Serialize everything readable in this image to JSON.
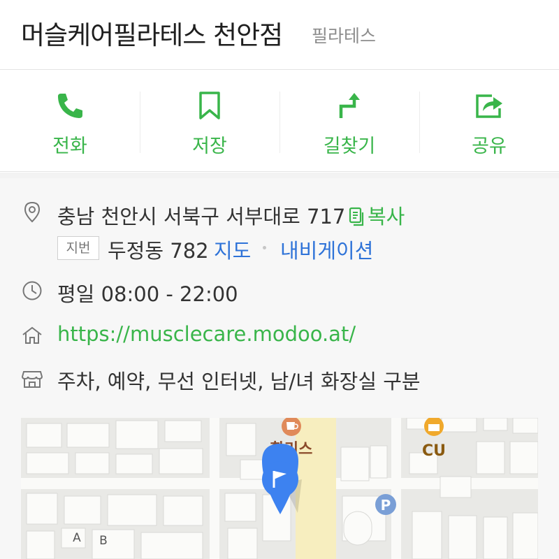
{
  "place": {
    "name": "머슬케어필라테스 천안점",
    "category": "필라테스"
  },
  "actions": [
    {
      "label": "전화",
      "icon": "phone-icon"
    },
    {
      "label": "저장",
      "icon": "bookmark-icon"
    },
    {
      "label": "길찾기",
      "icon": "directions-icon"
    },
    {
      "label": "공유",
      "icon": "share-icon"
    }
  ],
  "info": {
    "road_address": "충남 천안시 서북구 서부대로 717",
    "copy_label": "복사",
    "jibun_badge": "지번",
    "jibun_address": "두정동 782",
    "map_link": "지도",
    "navi_link": "내비게이션",
    "hours": "평일 08:00 - 22:00",
    "website": "https://musclecare.modoo.at/",
    "amenities": "주차, 예약, 무선 인터넷, 남/녀 화장실 구분"
  },
  "map": {
    "poi_hollys": "할리스",
    "poi_cu": "CU",
    "parking": "P",
    "building_a": "A",
    "building_b": "B"
  },
  "colors": {
    "accent_green": "#39b54a",
    "link_blue": "#2f73d8",
    "marker_blue": "#3d82f0"
  }
}
